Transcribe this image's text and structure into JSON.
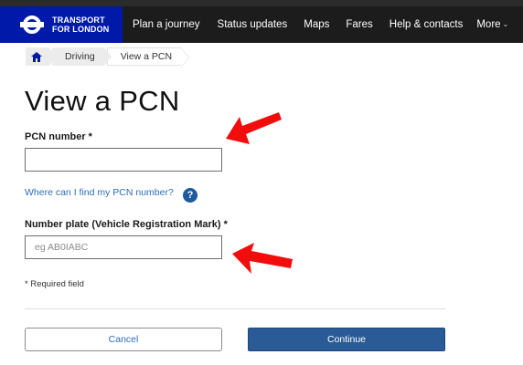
{
  "header": {
    "brand_line1": "TRANSPORT",
    "brand_line2": "FOR LONDON",
    "nav": {
      "plan": "Plan a journey",
      "status": "Status updates",
      "maps": "Maps",
      "fares": "Fares",
      "help": "Help & contacts",
      "more": "More"
    }
  },
  "breadcrumb": {
    "home_icon": "home-icon",
    "driving": "Driving",
    "current": "View a PCN"
  },
  "main": {
    "title": "View a PCN",
    "pcn_label": "PCN number *",
    "pcn_value": "",
    "help_link": "Where can I find my PCN number?",
    "help_icon": "?",
    "plate_label": "Number plate (Vehicle Registration Mark) *",
    "plate_placeholder": "eg AB0IABC",
    "required_note": "* Required field",
    "cancel": "Cancel",
    "continue": "Continue"
  },
  "colors": {
    "brand_blue": "#0019a8",
    "nav_background": "#1c1c1c",
    "link_blue": "#2a6ebb",
    "continue_button": "#2a5b96",
    "annotation_arrow": "#f20d0d"
  },
  "annotations": {
    "arrow_icon": "red-arrow-icon"
  }
}
